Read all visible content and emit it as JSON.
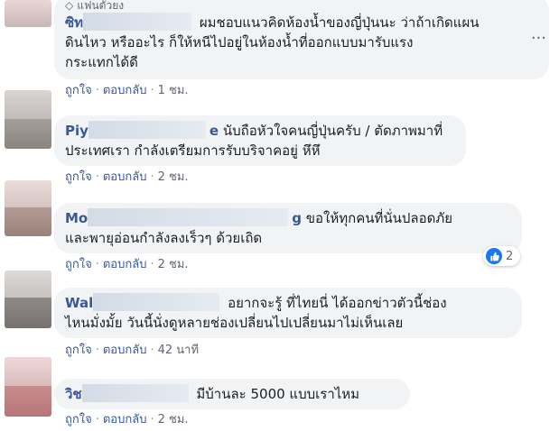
{
  "badge": "แฟนตัวยง",
  "labels": {
    "like": "ถูกใจ",
    "reply": "ตอบกลับ",
    "more": "···"
  },
  "comments": [
    {
      "author_visible": "ซิท",
      "author_tail": "",
      "text_line1": "ผมชอบแนวคิดห้องน้ำของญี่ปุ่นนะ ว่าถ้าเกิดแผน",
      "text_line2": "ดินไหว หรืออะไร ก็ให้หนีไปอยู่ในห้องน้ำที่ออกแบบมารับแรง",
      "text_line3": "กระแทกได้ดี",
      "time": "1 ชม."
    },
    {
      "author_visible": "Piy",
      "author_tail": "e",
      "text_line1": "นับถือหัวใจคนญี่ปุ่นครับ / ตัดภาพมาที่",
      "text_line2": "ประเทศเรา กำลังเตรียมการรับบริจาคอยู่ หึหึ",
      "time": "2 ชม."
    },
    {
      "author_visible": "Mo",
      "author_tail": "g",
      "text_line1": "ขอให้ทุกคนที่นั่นปลอดภัย",
      "text_line2": "และพายุอ่อนกำลังลงเร็วๆ ด้วยเถิด",
      "time": "2 ชม.",
      "reaction_count": "2"
    },
    {
      "author_visible": "Wal",
      "author_tail": "",
      "text_line1": "อยากจะรู้ ที่ไทยนี่ ได้ออกข่าวตัวนี้ช่อง",
      "text_line2": "ไหนมั่งมั้ย วันนี้นั่งดูหลายช่องเปลี่ยนไปเปลี่ยนมาไม่เห็นเลย",
      "time": "42 นาที"
    },
    {
      "author_visible": "วิช",
      "author_tail": "",
      "text_line1": "มีบ้านละ 5000 แบบเราไหม",
      "time": "2 ชม."
    }
  ],
  "colors": {
    "link": "#385898",
    "bubble": "#f2f3f5",
    "meta": "#606770",
    "like_blue": "#1877f2"
  }
}
